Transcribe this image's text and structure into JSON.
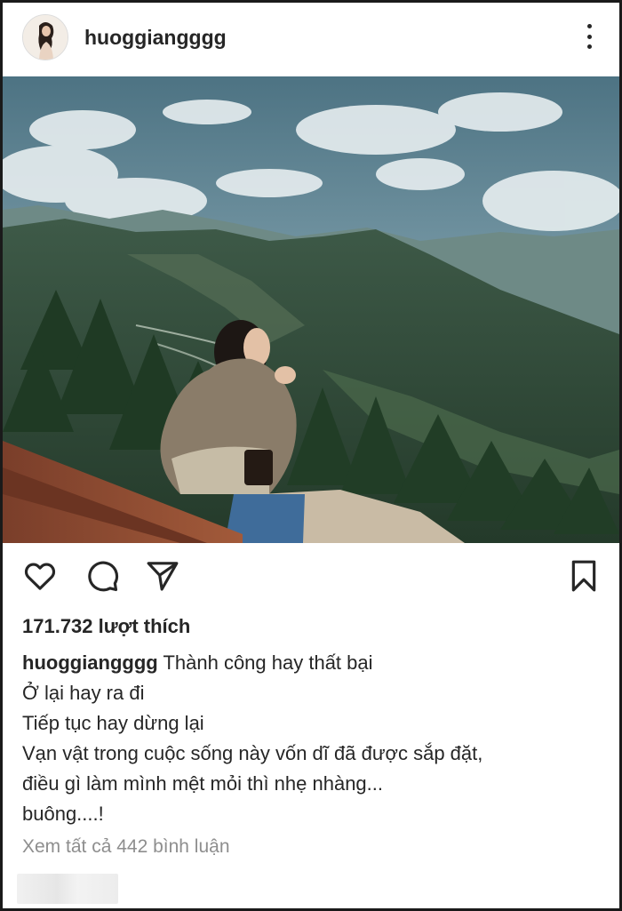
{
  "post": {
    "username": "huoggiangggg",
    "likes": "171.732 lượt thích",
    "caption": {
      "username": "huoggiangggg",
      "lines": [
        "Thành công hay thất bại",
        "Ở lại hay ra đi",
        "Tiếp tục hay dừng lại",
        "Vạn vật trong cuộc sống này vốn dĩ đã được sắp đặt,",
        "điều gì làm mình mệt mỏi thì nhẹ nhàng...",
        "buông....!"
      ]
    },
    "view_comments": "Xem tất cả 442 bình luận"
  },
  "icons": {
    "avatar": "profile-photo",
    "more": "more-vertical-icon",
    "like": "heart-outline-icon",
    "comment": "comment-bubble-icon",
    "share": "paper-plane-icon",
    "save": "bookmark-outline-icon"
  },
  "colors": {
    "text": "#262626",
    "muted": "#8e8e8e",
    "border": "#1a1a1a",
    "sky": "#5f8394",
    "mountain": "#2f4a35"
  }
}
